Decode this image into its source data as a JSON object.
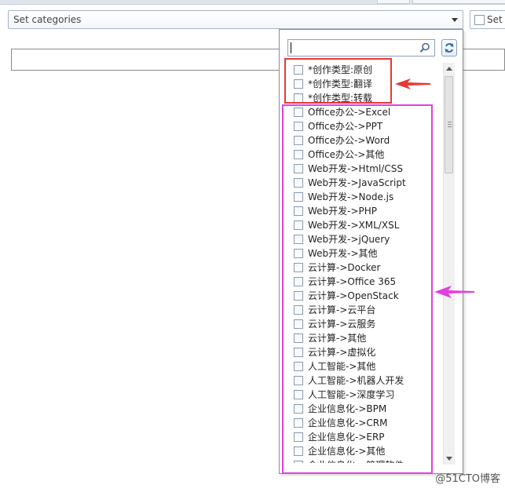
{
  "dropdown": {
    "placeholder": "Set categories"
  },
  "side_option": {
    "label": "Set p"
  },
  "search": {
    "value": ""
  },
  "categories": [
    "*创作类型:原创",
    "*创作类型:翻译",
    "*创作类型:转载",
    "Office办公->Excel",
    "Office办公->PPT",
    "Office办公->Word",
    "Office办公->其他",
    "Web开发->Html/CSS",
    "Web开发->JavaScript",
    "Web开发->Node.js",
    "Web开发->PHP",
    "Web开发->XML/XSL",
    "Web开发->jQuery",
    "Web开发->其他",
    "云计算->Docker",
    "云计算->Office 365",
    "云计算->OpenStack",
    "云计算->云平台",
    "云计算->云服务",
    "云计算->其他",
    "云计算->虚拟化",
    "人工智能->其他",
    "人工智能->机器人开发",
    "人工智能->深度学习",
    "企业信息化->BPM",
    "企业信息化->CRM",
    "企业信息化->ERP",
    "企业信息化->其他",
    "企业信息化->管理软件"
  ],
  "annotations": {
    "red_color": "#e53935",
    "pink_color": "#e040e0"
  },
  "watermark": "@51CTO博客"
}
